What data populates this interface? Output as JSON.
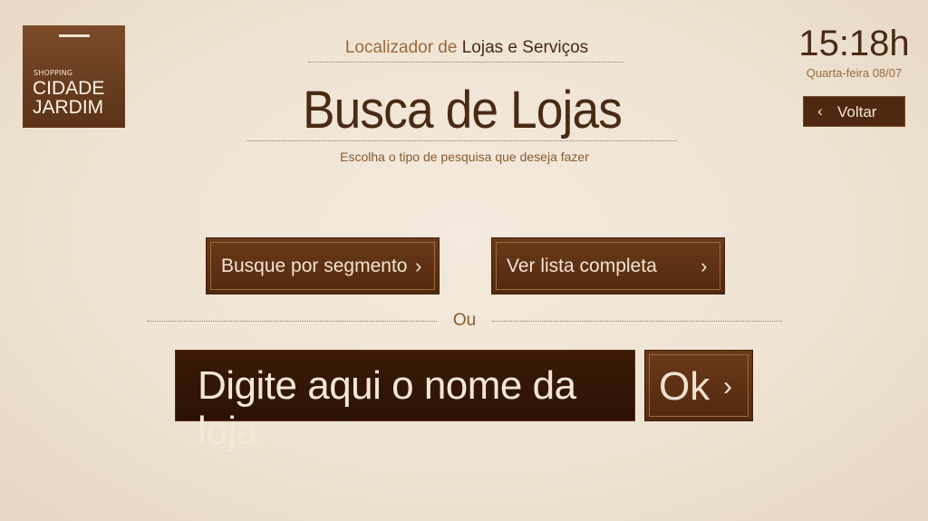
{
  "logo": {
    "small": "SHOPPING",
    "line1": "CIDADE",
    "line2": "JARDIM"
  },
  "header": {
    "pre": "Localizador de",
    "post": "Lojas e Serviços",
    "title": "Busca de Lojas",
    "hint": "Escolha o tipo de pesquisa que deseja fazer"
  },
  "clock": {
    "time": "15:18h",
    "date": "Quarta-feira 08/07"
  },
  "back": {
    "chevron": "‹",
    "label": "Voltar"
  },
  "options": {
    "segment_label": "Busque por segmento",
    "list_label": "Ver lista completa",
    "chevron": "›",
    "or": "Ou"
  },
  "search": {
    "placeholder": "Digite aqui o nome da loja",
    "ok_label": "Ok",
    "ok_chevron": "›"
  },
  "colors": {
    "background": "#efe3d3",
    "brand_brown": "#5b3218",
    "dark_input": "#2c1204",
    "accent": "#9b6a3d"
  }
}
